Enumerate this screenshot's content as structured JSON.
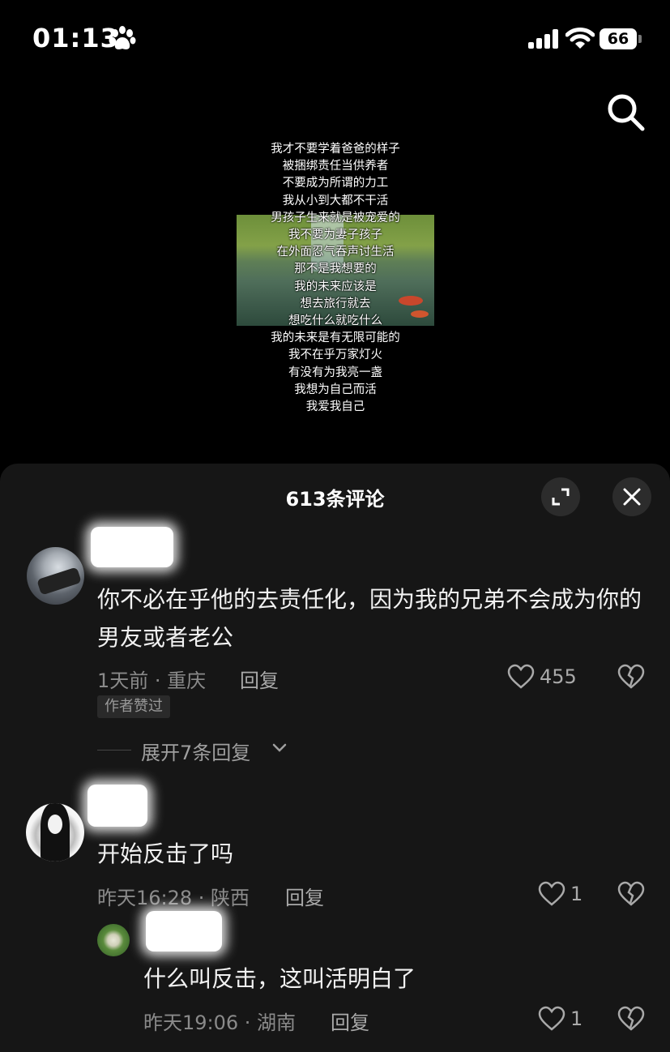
{
  "status_bar": {
    "time": "01:13",
    "battery": "66"
  },
  "lyrics": [
    "我才不要学着爸爸的样子",
    "被捆绑责任当供养者",
    "不要成为所谓的力工",
    "我从小到大都不干活",
    "男孩子生来就是被宠爱的",
    "我不要为妻子孩子",
    "在外面忍气吞声讨生活",
    "那不是我想要的",
    "我的未来应该是",
    "想去旅行就去",
    "想吃什么就吃什么",
    "我的未来是有无限可能的",
    "我不在乎万家灯火",
    "有没有为我亮一盏",
    "我想为自己而活",
    "我爱我自己"
  ],
  "panel": {
    "title": "613条评论"
  },
  "comments": [
    {
      "text": "你不必在乎他的去责任化，因为我的兄弟不会成为你的男友或者老公",
      "meta": "1天前 · 重庆",
      "reply": "回复",
      "likes": "455",
      "tag": "作者赞过",
      "expand": "展开7条回复"
    },
    {
      "text": "开始反击了吗",
      "meta": "昨天16:28 · 陕西",
      "reply": "回复",
      "likes": "1"
    },
    {
      "text": "什么叫反击，这叫活明白了",
      "meta": "昨天19:06 · 湖南",
      "reply": "回复",
      "likes": "1"
    }
  ],
  "colors": {
    "background": "#000000",
    "panel": "#161616",
    "text": "#f1f1f1",
    "meta": "#8a8a8a"
  },
  "icons": [
    "paw-icon",
    "signal-icon",
    "wifi-icon",
    "battery-icon",
    "search-icon",
    "expand-icon",
    "close-icon",
    "heart-icon",
    "broken-heart-icon",
    "chevron-down-icon"
  ]
}
